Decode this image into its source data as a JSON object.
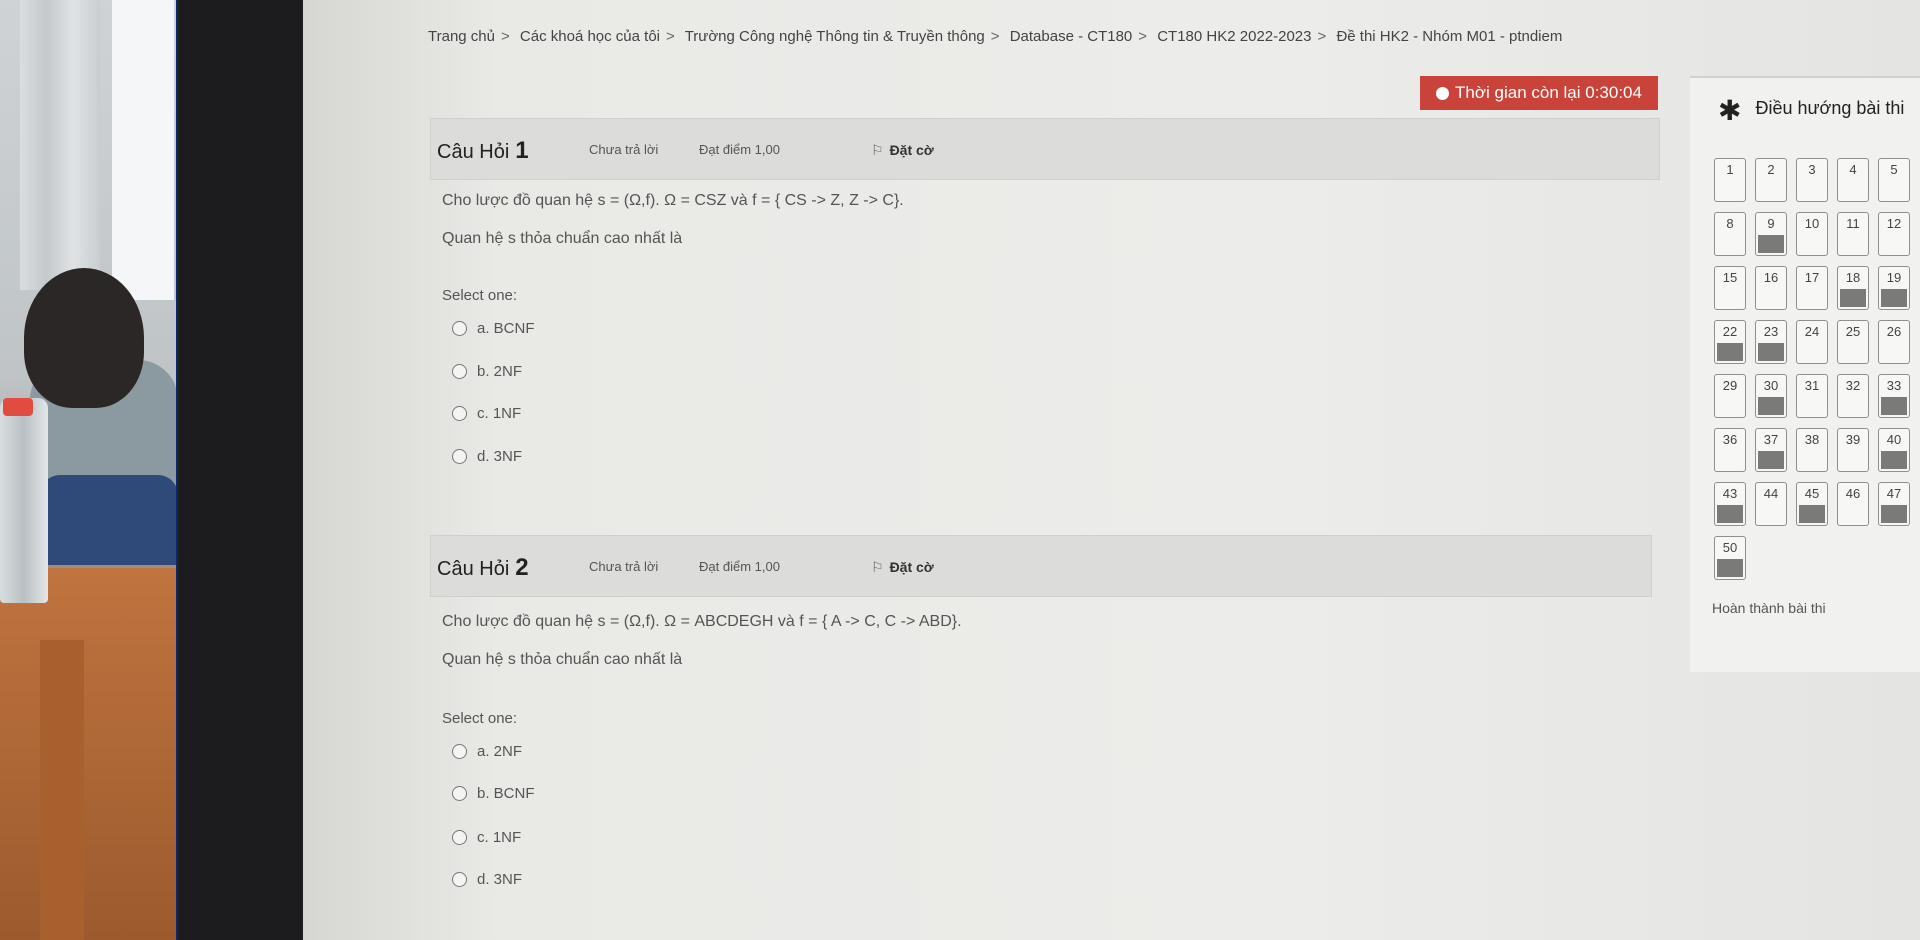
{
  "breadcrumb": [
    "Trang chủ",
    "Các khoá học của tôi",
    "Trường Công nghệ Thông tin & Truyền thông",
    "Database - CT180",
    "CT180 HK2 2022-2023",
    "Đề thi HK2 - Nhóm M01 - ptndiem"
  ],
  "timer": {
    "label": "Thời gian còn lại 0:30:04"
  },
  "questions": [
    {
      "label": "Câu Hỏi",
      "number": "1",
      "status": "Chưa trả lời",
      "score": "Đạt điểm 1,00",
      "flag": "Đặt cờ",
      "text": "Cho lược đồ quan hệ s = (Ω,f). Ω = CSZ và f = { CS -> Z, Z -> C}.",
      "prompt": "Quan hệ s thỏa chuẩn cao nhất là",
      "select_label": "Select one:",
      "options": [
        "a.  BCNF",
        "b.  2NF",
        "c.  1NF",
        "d.  3NF"
      ]
    },
    {
      "label": "Câu Hỏi",
      "number": "2",
      "status": "Chưa trả lời",
      "score": "Đạt điểm 1,00",
      "flag": "Đặt cờ",
      "text": "Cho lược đồ quan hệ s = (Ω,f). Ω = ABCDEGH và f = { A -> C, C -> ABD}.",
      "prompt": "Quan hệ s thỏa chuẩn cao nhất là",
      "select_label": "Select one:",
      "options": [
        "a.  2NF",
        "b.  BCNF",
        "c.  1NF",
        "d.  3NF"
      ]
    }
  ],
  "navigation": {
    "title": "Điều hướng bài thi",
    "rows": [
      [
        {
          "n": "1",
          "a": false
        },
        {
          "n": "2",
          "a": false
        },
        {
          "n": "3",
          "a": false
        },
        {
          "n": "4",
          "a": false
        },
        {
          "n": "5",
          "a": false
        }
      ],
      [
        {
          "n": "8",
          "a": false
        },
        {
          "n": "9",
          "a": true
        },
        {
          "n": "10",
          "a": false
        },
        {
          "n": "11",
          "a": false
        },
        {
          "n": "12",
          "a": false
        }
      ],
      [
        {
          "n": "15",
          "a": false
        },
        {
          "n": "16",
          "a": false
        },
        {
          "n": "17",
          "a": false
        },
        {
          "n": "18",
          "a": true
        },
        {
          "n": "19",
          "a": true
        }
      ],
      [
        {
          "n": "22",
          "a": true
        },
        {
          "n": "23",
          "a": true
        },
        {
          "n": "24",
          "a": false
        },
        {
          "n": "25",
          "a": false
        },
        {
          "n": "26",
          "a": false
        }
      ],
      [
        {
          "n": "29",
          "a": false
        },
        {
          "n": "30",
          "a": true
        },
        {
          "n": "31",
          "a": false
        },
        {
          "n": "32",
          "a": false
        },
        {
          "n": "33",
          "a": true
        }
      ],
      [
        {
          "n": "36",
          "a": false
        },
        {
          "n": "37",
          "a": true
        },
        {
          "n": "38",
          "a": false
        },
        {
          "n": "39",
          "a": false
        },
        {
          "n": "40",
          "a": true
        }
      ],
      [
        {
          "n": "43",
          "a": true
        },
        {
          "n": "44",
          "a": false
        },
        {
          "n": "45",
          "a": true
        },
        {
          "n": "46",
          "a": false
        },
        {
          "n": "47",
          "a": true
        }
      ],
      [
        {
          "n": "50",
          "a": true
        }
      ]
    ],
    "finish_label": "Hoàn thành bài thi"
  }
}
